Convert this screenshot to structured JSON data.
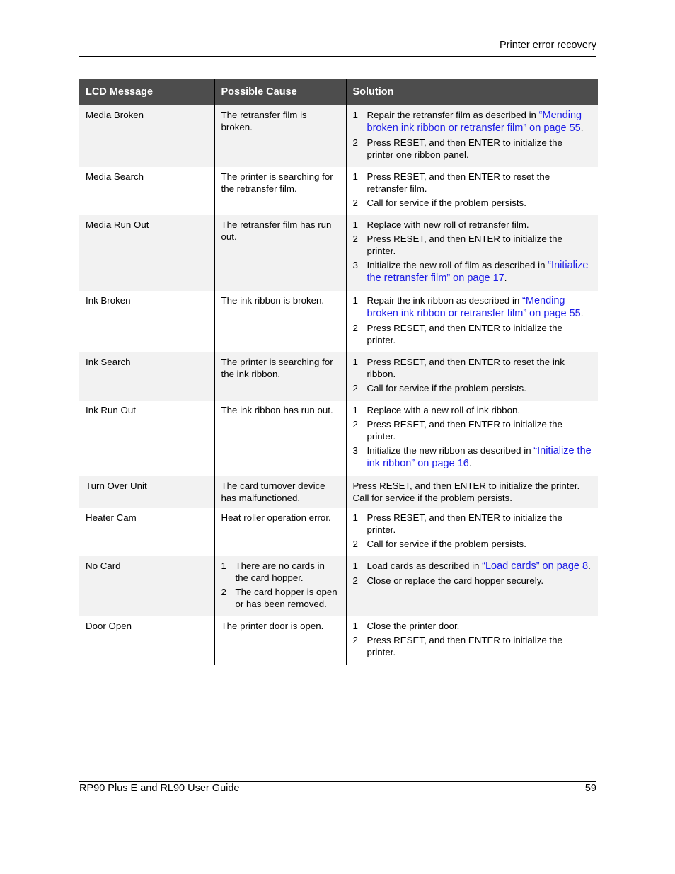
{
  "header": {
    "section_title": "Printer error recovery"
  },
  "table": {
    "columns": [
      "LCD Message",
      "Possible Cause",
      "Solution"
    ],
    "rows": [
      {
        "message": "Media Broken",
        "cause": {
          "text": "The retransfer film is broken."
        },
        "solution": {
          "steps": [
            {
              "num": "1",
              "text": "Repair the retransfer film as described in ",
              "link": "“Mending broken ink ribbon or retransfer film” on page 55",
              "after": "."
            },
            {
              "num": "2",
              "text": "Press RESET, and then ENTER to initialize the printer one ribbon panel."
            }
          ]
        }
      },
      {
        "message": "Media Search",
        "cause": {
          "text": "The printer is searching for the retransfer film."
        },
        "solution": {
          "steps": [
            {
              "num": "1",
              "text": "Press RESET, and then ENTER to reset the retransfer film."
            },
            {
              "num": "2",
              "text": "Call for service if the problem persists."
            }
          ]
        }
      },
      {
        "message": "Media Run Out",
        "cause": {
          "text": "The retransfer film has run out."
        },
        "solution": {
          "steps": [
            {
              "num": "1",
              "text": "Replace with new roll of retransfer film."
            },
            {
              "num": "2",
              "text": "Press RESET, and then ENTER to initialize the printer."
            },
            {
              "num": "3",
              "text": "Initialize the new roll of film as described in ",
              "link": "“Initialize the retransfer film” on page 17",
              "after": "."
            }
          ]
        }
      },
      {
        "message": "Ink Broken",
        "cause": {
          "text": "The ink ribbon is broken."
        },
        "solution": {
          "steps": [
            {
              "num": "1",
              "text": "Repair the ink ribbon as described in ",
              "link": "“Mending broken ink ribbon or retransfer film” on page 55",
              "after": "."
            },
            {
              "num": "2",
              "text": "Press RESET, and then ENTER to initialize the printer."
            }
          ]
        }
      },
      {
        "message": "Ink Search",
        "cause": {
          "text": "The printer is searching for the ink ribbon."
        },
        "solution": {
          "steps": [
            {
              "num": "1",
              "text": "Press RESET, and then ENTER to reset the ink ribbon."
            },
            {
              "num": "2",
              "text": "Call for service if the problem persists."
            }
          ]
        }
      },
      {
        "message": "Ink Run Out",
        "cause": {
          "text": "The ink ribbon has run out."
        },
        "solution": {
          "steps": [
            {
              "num": "1",
              "text": "Replace with a new roll of ink ribbon."
            },
            {
              "num": "2",
              "text": "Press RESET, and then ENTER to initialize the printer."
            },
            {
              "num": "3",
              "text": "Initialize the new ribbon as described in ",
              "link": "“Initialize the ink ribbon” on page 16",
              "after": "."
            }
          ]
        }
      },
      {
        "message": "Turn Over Unit",
        "cause": {
          "text": "The card turnover device has malfunctioned."
        },
        "solution": {
          "plain": [
            "Press RESET, and then ENTER to initialize the printer.",
            "Call for service if the problem persists."
          ]
        }
      },
      {
        "message": "Heater Cam",
        "cause": {
          "text": "Heat roller operation error."
        },
        "solution": {
          "steps": [
            {
              "num": "1",
              "text": "Press RESET, and then ENTER to initialize the printer."
            },
            {
              "num": "2",
              "text": "Call for service if the problem persists."
            }
          ]
        }
      },
      {
        "message": "No Card",
        "cause": {
          "steps": [
            {
              "num": "1",
              "text": "There are no cards in the card hopper."
            },
            {
              "num": "2",
              "text": "The card hopper is open or has been removed."
            }
          ]
        },
        "solution": {
          "steps": [
            {
              "num": "1",
              "text": "Load cards as described in ",
              "link": "“Load cards” on page 8",
              "after": "."
            },
            {
              "num": "2",
              "text": "Close or replace the card hopper securely."
            }
          ]
        }
      },
      {
        "message": "Door Open",
        "cause": {
          "text": "The printer door is open."
        },
        "solution": {
          "steps": [
            {
              "num": "1",
              "text": "Close the printer door."
            },
            {
              "num": "2",
              "text": "Press RESET, and then ENTER to initialize the printer."
            }
          ]
        }
      }
    ]
  },
  "footer": {
    "guide_title": "RP90 Plus E and RL90 User Guide",
    "page_number": "59"
  },
  "colors": {
    "header_bg": "#4d4d4d",
    "shade_bg": "#f2f2f2",
    "link": "#1a1ae6"
  }
}
